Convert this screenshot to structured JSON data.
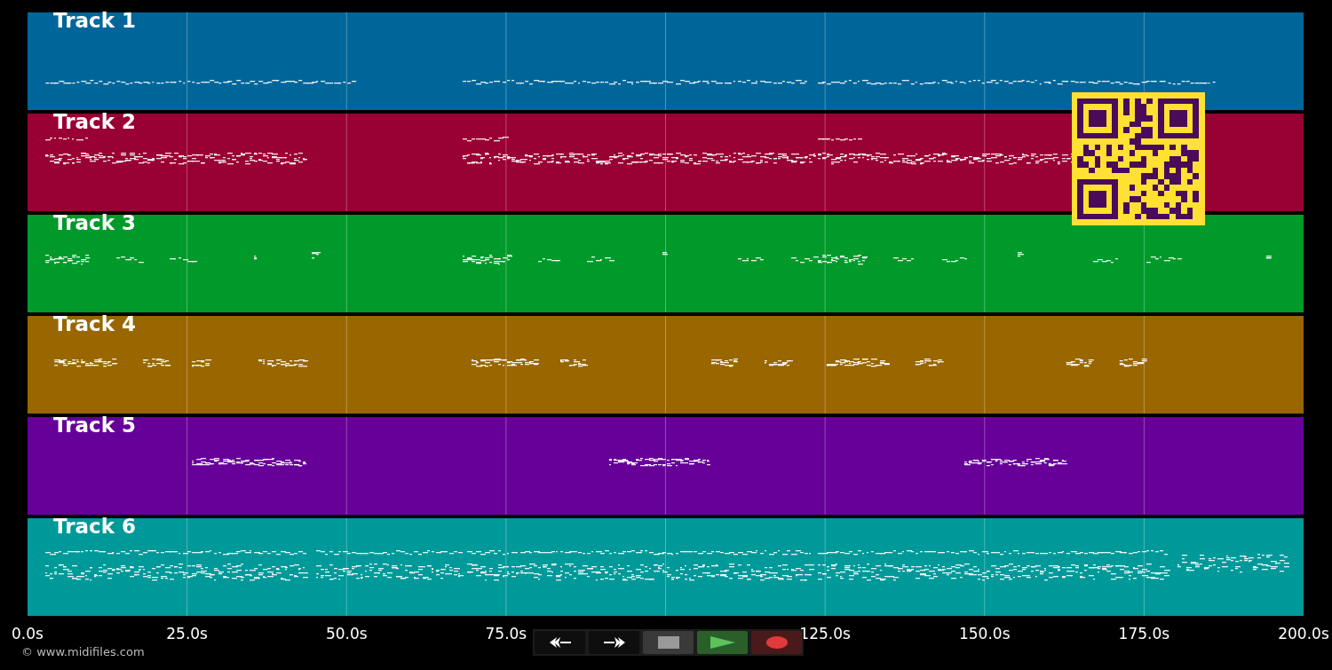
{
  "tracks": [
    {
      "title": "Track 1",
      "color": "#006699"
    },
    {
      "title": "Track 2",
      "color": "#990033"
    },
    {
      "title": "Track 3",
      "color": "#009a2a"
    },
    {
      "title": "Track 4",
      "color": "#996600"
    },
    {
      "title": "Track 5",
      "color": "#660099"
    },
    {
      "title": "Track 6",
      "color": "#009999"
    }
  ],
  "axis": {
    "ticks": [
      {
        "label": "0.0s"
      },
      {
        "label": "25.0s"
      },
      {
        "label": "50.0s"
      },
      {
        "label": "75.0s"
      },
      {
        "label": "125.0s"
      },
      {
        "label": "150.0s"
      },
      {
        "label": "175.0s"
      },
      {
        "label": "200.0s"
      }
    ]
  },
  "controls": [
    {
      "kind": "rewind"
    },
    {
      "kind": "fast-forward"
    },
    {
      "kind": "stop"
    },
    {
      "kind": "play"
    },
    {
      "kind": "record"
    }
  ],
  "footer": {
    "copyright": "© www.midifiles.com"
  }
}
